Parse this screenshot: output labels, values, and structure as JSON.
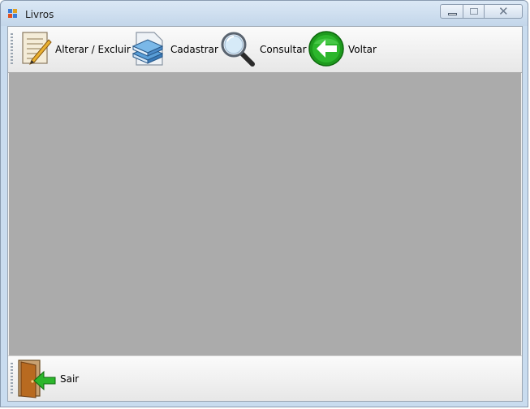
{
  "window": {
    "title": "Livros",
    "controls": {
      "minimize": "minimize",
      "maximize": "maximize",
      "close": "close"
    },
    "close_glyph": "✕"
  },
  "toolbar": {
    "items": [
      {
        "label": "Alterar / Excluir",
        "icon": "pencil-document-icon"
      },
      {
        "label": "Cadastrar",
        "icon": "books-icon"
      },
      {
        "label": "Consultar",
        "icon": "magnifier-icon"
      },
      {
        "label": "Voltar",
        "icon": "back-arrow-icon"
      }
    ]
  },
  "bottom_toolbar": {
    "exit": {
      "label": "Sair",
      "icon": "door-exit-icon"
    }
  },
  "colors": {
    "content_background": "#ababab",
    "titlebar": "#c3d6ea",
    "back_arrow": "#1e9a1e"
  }
}
